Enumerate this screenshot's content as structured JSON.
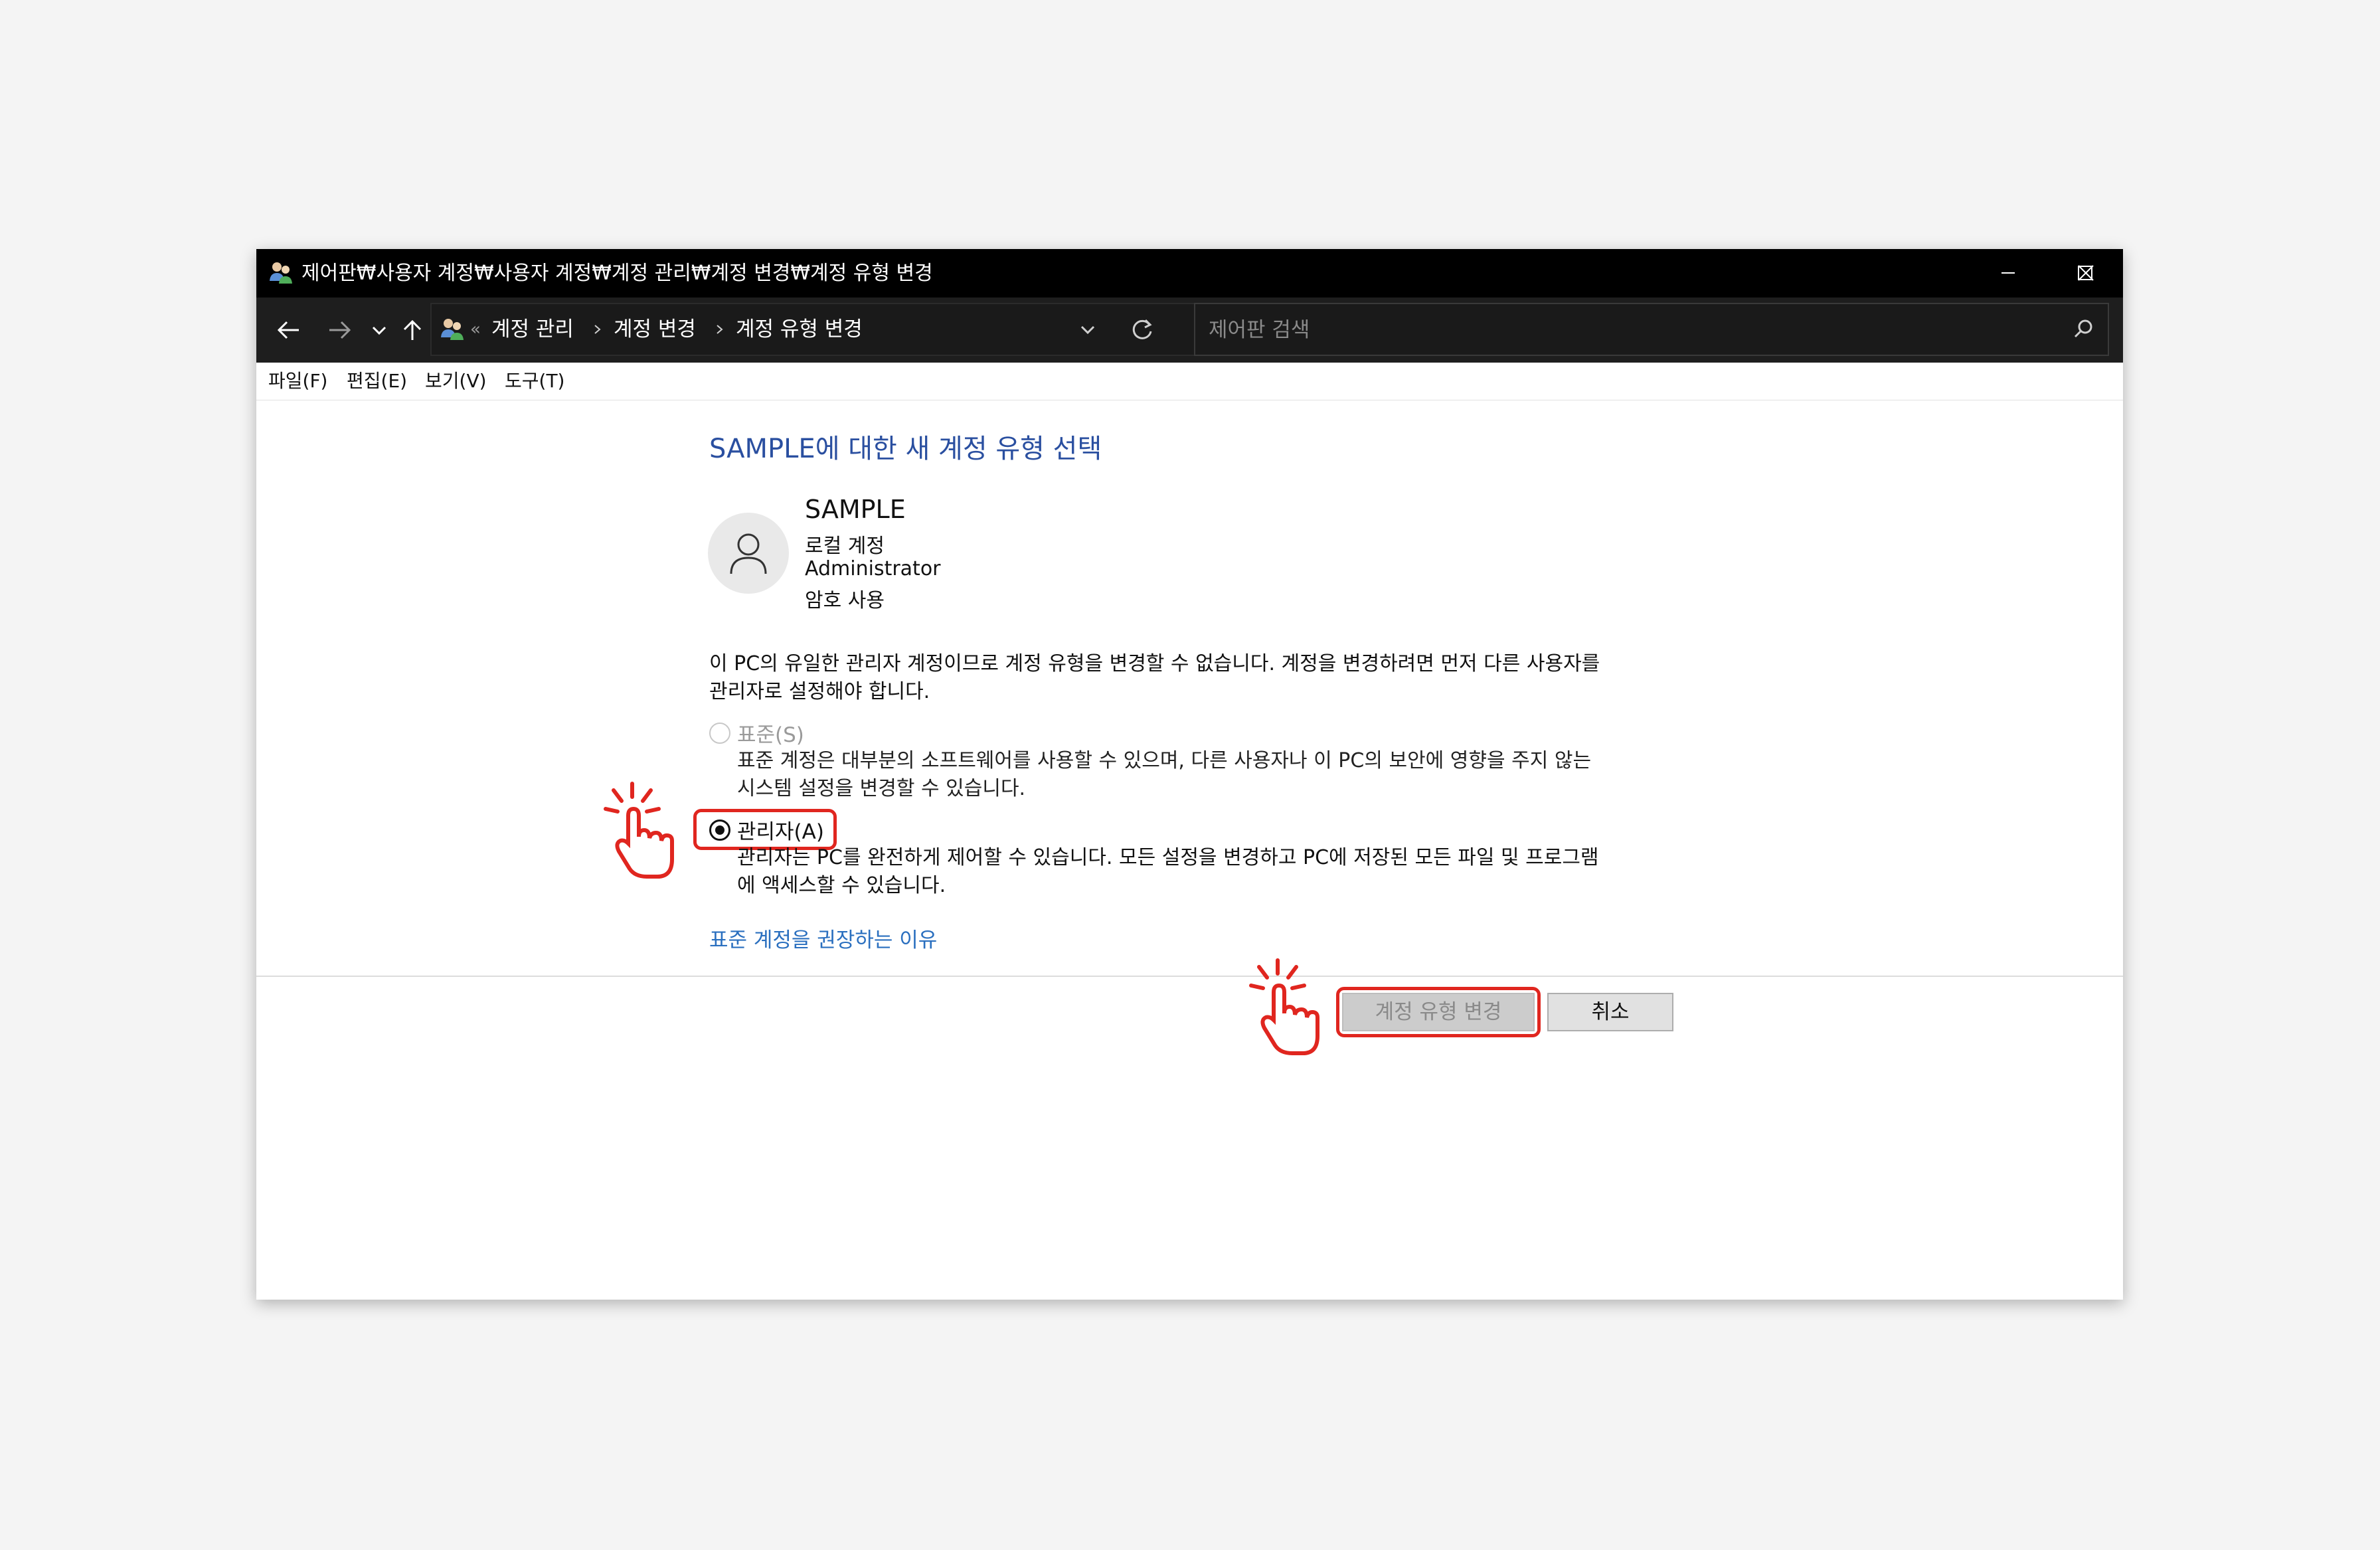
{
  "window": {
    "title": "제어판₩사용자 계정₩사용자 계정₩계정 관리₩계정 변경₩계정 유형 변경"
  },
  "address_bar": {
    "overflow": "«",
    "crumbs": [
      "계정 관리",
      "계정 변경",
      "계정 유형 변경"
    ]
  },
  "search": {
    "placeholder": "제어판 검색"
  },
  "menu": [
    "파일(F)",
    "편집(E)",
    "보기(V)",
    "도구(T)"
  ],
  "main": {
    "heading": "SAMPLE에 대한 새 계정 유형 선택",
    "account": {
      "name": "SAMPLE",
      "lines": [
        "로컬 계정",
        "Administrator",
        "암호 사용"
      ]
    },
    "notice_lines": [
      "이 PC의 유일한 관리자 계정이므로 계정 유형을 변경할 수 없습니다. 계정을 변경하려면 먼저 다른 사용자를",
      "관리자로 설정해야 합니다."
    ],
    "options": [
      {
        "label": "표준(S)",
        "state": "disabled",
        "desc": [
          "표준 계정은 대부분의 소프트웨어를 사용할 수 있으며, 다른 사용자나 이 PC의 보안에 영향을 주지 않는",
          "시스템 설정을 변경할 수 있습니다."
        ]
      },
      {
        "label": "관리자(A)",
        "state": "checked",
        "desc": [
          "관리자는 PC를 완전하게 제어할 수 있습니다. 모든 설정을 변경하고 PC에 저장된 모든 파일 및 프로그램",
          "에 액세스할 수 있습니다."
        ]
      }
    ],
    "link": "표준 계정을 권장하는 이유"
  },
  "buttons": {
    "change": "계정 유형 변경",
    "cancel": "취소"
  },
  "colors": {
    "titlebar": "#000000",
    "navbar": "#1e1e1e",
    "heading": "#2a4fa0",
    "link": "#2a6fbf",
    "highlight": "#e0261f"
  }
}
